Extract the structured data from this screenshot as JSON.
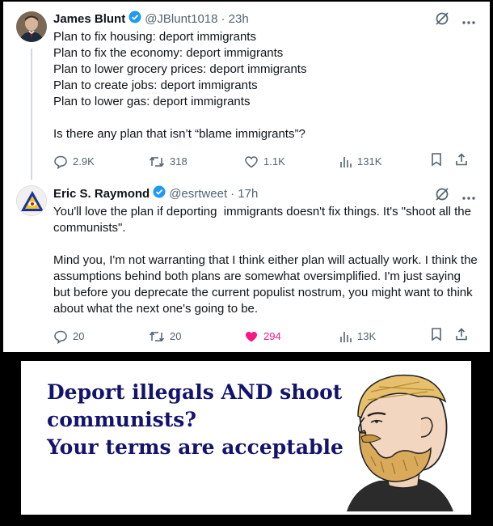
{
  "tweets": [
    {
      "name": "James Blunt",
      "handle": "@JBlunt1018",
      "time": "· 23h",
      "body": "Plan to fix housing: deport immigrants\nPlan to fix the economy: deport immigrants\nPlan to lower grocery prices: deport immigrants\nPlan to create jobs: deport immigrants\nPlan to lower gas: deport immigrants\n\nIs there any plan that isn’t “blame immigrants”?",
      "replies": "2.9K",
      "reposts": "318",
      "likes": "1.1K",
      "views": "131K",
      "liked": false
    },
    {
      "name": "Eric S. Raymond",
      "handle": "@esrtweet",
      "time": "· 17h",
      "body": "You'll love the plan if deporting  immigrants doesn't fix things. It's \"shoot all the communists\".\n\nMind you, I'm not warranting that I think either plan will actually work. I think the assumptions behind both plans are somewhat oversimplified. I'm just saying but before you deprecate the current populist nostrum, you might want to think about what the next one's going to be.",
      "replies": "20",
      "reposts": "20",
      "likes": "294",
      "views": "13K",
      "liked": true
    }
  ],
  "meme": {
    "line1": "Deport illegals AND shoot",
    "line2": "communists?",
    "line3": "Your terms are acceptable"
  },
  "colors": {
    "verified": "#1d9bf0",
    "like_active": "#f91880",
    "meme_text": "#13136e",
    "secondary_text": "#536471"
  },
  "icons": [
    "verified-badge-icon",
    "grok-icon",
    "more-icon",
    "reply-icon",
    "repost-icon",
    "like-icon",
    "views-icon",
    "bookmark-icon",
    "share-icon"
  ]
}
